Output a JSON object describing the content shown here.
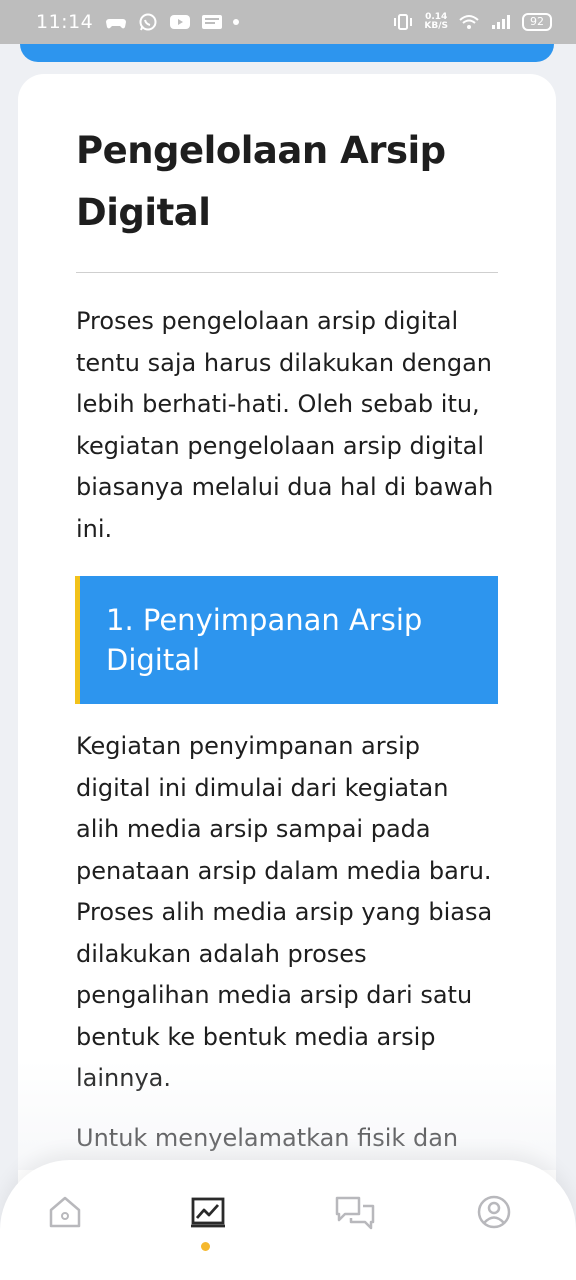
{
  "status_bar": {
    "time": "11:14",
    "net_speed_value": "0.14",
    "net_speed_unit": "KB/S",
    "battery": "92",
    "icons": [
      "game-controller-icon",
      "whatsapp-icon",
      "youtube-icon",
      "news-icon",
      "dot-icon",
      "vibrate-icon",
      "wifi-icon",
      "signal-icon",
      "battery-icon"
    ]
  },
  "article": {
    "title": "Pengelolaan Arsip Digital",
    "intro": "Proses pengelolaan arsip digital tentu saja harus dilakukan dengan lebih berhati-hati. Oleh sebab itu, kegiatan pengelolaan arsip digital biasanya melalui dua hal di bawah ini.",
    "section1_title": "1. Penyimpanan Arsip Digital",
    "section1_para": "Kegiatan penyimpanan arsip digital ini dimulai dari kegiatan alih media arsip sampai pada penataan arsip dalam media baru. Proses alih media arsip yang biasa dilakukan adalah proses pengalihan media arsip dari satu bentuk ke bentuk media arsip lainnya.",
    "para_next": "Untuk menyelamatkan fisik dan informasi arsip, ada beberapa"
  },
  "bottom_nav": {
    "items": [
      "home-icon",
      "chart-icon",
      "chat-icon",
      "profile-icon"
    ],
    "active_index": 1
  },
  "colors": {
    "accent_blue": "#2d95ee",
    "accent_yellow": "#f2c21b",
    "active_dot": "#f5b82e",
    "text": "#1e1e1e"
  }
}
